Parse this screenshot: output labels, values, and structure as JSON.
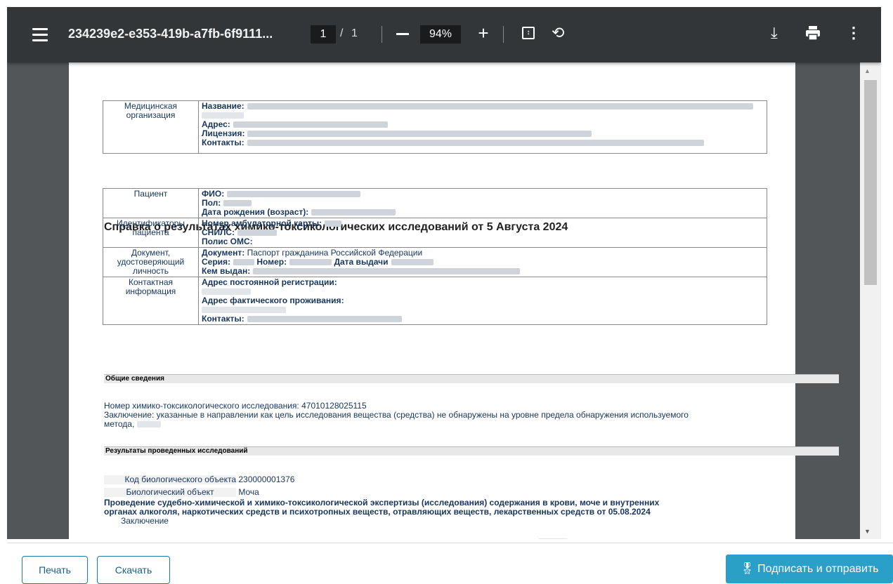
{
  "viewer": {
    "title": "234239e2-e353-419b-a7fb-6f9111...",
    "page_current": "1",
    "page_sep": "/",
    "page_total": "1",
    "zoom": "94%",
    "icons": [
      "menu-icon",
      "zoom-out-icon",
      "zoom-in-icon",
      "fit-page-icon",
      "rotate-icon",
      "download-icon",
      "print-icon",
      "more-icon"
    ],
    "colors": {
      "toolbar": "#323639",
      "background": "#525659"
    }
  },
  "doc": {
    "org_label": "Медицинская организация",
    "org_name": "Название:",
    "org_address": "Адрес:",
    "org_license": "Лицензия:",
    "org_contacts": "Контакты:",
    "heading": "Справка о результатах химико-токсикологических исследований от 5 Августа 2024",
    "patient_label": "Пациент",
    "fio": "ФИО:",
    "sex": "Пол:",
    "dob": "Дата рождения (возраст):",
    "ids_label": "Идентификаторы пациента",
    "card_number": "Номер амбулаторной карты:",
    "snils": "СНИЛС:",
    "oms": "Полис ОМС:",
    "document_label": "Документ, удостоверяющий личность",
    "document_key": "Документ:",
    "document_value": "Паспорт гражданина Российской Федерации",
    "series": "Серия:",
    "number": "Номер:",
    "issue_date": "Дата выдачи",
    "issued_by": "Кем выдан:",
    "contacts_label": "Контактная информация",
    "reg_address": "Адрес постоянной регистрации:",
    "actual_address": "Адрес фактического проживания:",
    "contacts": "Контакты:",
    "general_header": "Общие сведения",
    "test_number": "Номер химико-токсикологического исследования: 47010128025115",
    "conclusion": "Заключение: указанные в направлении как цель исследования вещества (средства) не обнаружены на уровне предела обнаружения используемого",
    "conclusion_end": "метода,",
    "results_header": "Результаты проведенных исследований",
    "bio_code_label": "Код биологического объекта",
    "bio_code_value": "230000001376",
    "bio_object_label": "Биологический объект",
    "bio_object_value": "Моча",
    "procedure_line1": "Проведение судебно-химической и химико-токсикологической экспертизы (исследования) содержания в крови, моче и внутренних",
    "procedure_line2": "органах алкоголя, наркотических средств и психотропных веществ, отравляющих веществ, лекарственных средств от 05.08.2024",
    "conclusion_label": "Заключение"
  },
  "actions": {
    "print": "Печать",
    "download": "Скачать",
    "sign_send": "Подписать и отправить",
    "sign_icon": "certificate-icon",
    "accent": "#2aa0c8"
  }
}
